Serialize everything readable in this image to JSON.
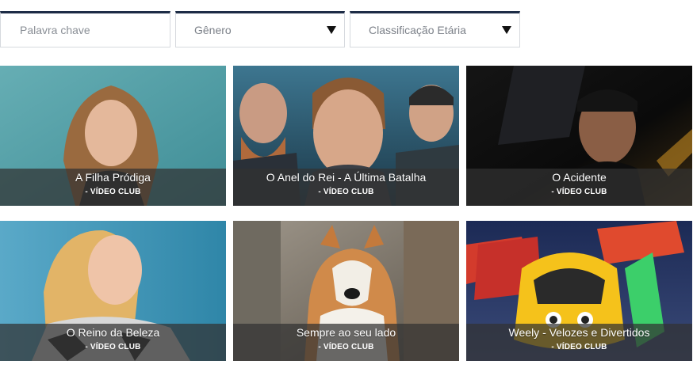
{
  "filters": {
    "keyword_placeholder": "Palavra chave",
    "genre_label": "Gênero",
    "rating_label": "Classificação Etária"
  },
  "movies": [
    {
      "title": "A Filha Pródiga",
      "source": "- VÍDEO CLUB"
    },
    {
      "title": "O Anel do Rei - A Última Batalha",
      "source": "- VÍDEO CLUB"
    },
    {
      "title": "O Acidente",
      "source": "- VÍDEO CLUB"
    },
    {
      "title": "O Reino da Beleza",
      "source": "- VÍDEO CLUB"
    },
    {
      "title": "Sempre ao seu lado",
      "source": "- VÍDEO CLUB"
    },
    {
      "title": "Weely - Velozes e Divertidos",
      "source": "- VÍDEO CLUB"
    }
  ]
}
